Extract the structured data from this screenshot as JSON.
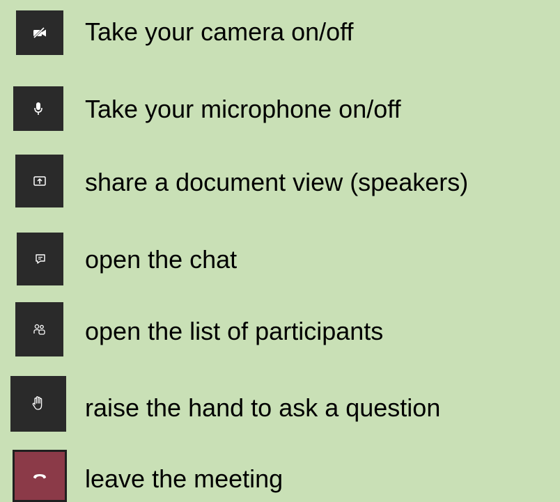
{
  "items": [
    {
      "label": "Take your camera on/off",
      "icon": "camera-off-icon"
    },
    {
      "label": "Take your microphone on/off",
      "icon": "microphone-icon"
    },
    {
      "label": "share a document view (speakers)",
      "icon": "share-screen-icon"
    },
    {
      "label": "open the chat",
      "icon": "chat-icon"
    },
    {
      "label": "open the list of participants",
      "icon": "participants-icon"
    },
    {
      "label": "raise the hand to ask a question",
      "icon": "raise-hand-icon"
    },
    {
      "label": "leave the meeting",
      "icon": "hang-up-icon"
    }
  ],
  "colors": {
    "background": "#c9e0b6",
    "button": "#2a2a2a",
    "leave_button": "#8b3a48"
  }
}
